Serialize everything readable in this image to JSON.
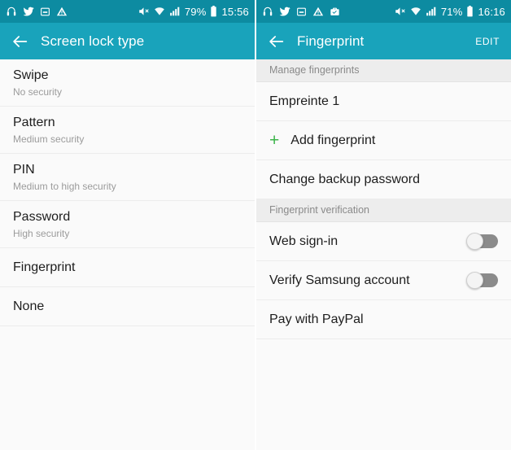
{
  "screens": [
    {
      "id": "screen-lock-type",
      "statusbar": {
        "left_icons": [
          "headphones-icon",
          "twitter-icon",
          "screenshot-icon",
          "warning-icon"
        ],
        "right_icons": [
          "mute-icon",
          "wifi-icon",
          "signal-icon"
        ],
        "battery": "79%",
        "battery_icon": "battery-icon",
        "time": "15:56"
      },
      "actionbar": {
        "back_icon": "back-arrow-icon",
        "title": "Screen lock type",
        "action_label": ""
      },
      "rows": [
        {
          "type": "item",
          "title": "Swipe",
          "sub": "No security"
        },
        {
          "type": "item",
          "title": "Pattern",
          "sub": "Medium security"
        },
        {
          "type": "item",
          "title": "PIN",
          "sub": "Medium to high security"
        },
        {
          "type": "item",
          "title": "Password",
          "sub": "High security"
        },
        {
          "type": "item",
          "title": "Fingerprint",
          "sub": ""
        },
        {
          "type": "item",
          "title": "None",
          "sub": ""
        }
      ]
    },
    {
      "id": "fingerprint",
      "statusbar": {
        "left_icons": [
          "headphones-icon",
          "twitter-icon",
          "screenshot-icon",
          "warning-icon",
          "briefcase-icon"
        ],
        "right_icons": [
          "mute-icon",
          "wifi-icon",
          "signal-icon"
        ],
        "battery": "71%",
        "battery_icon": "battery-icon",
        "time": "16:16"
      },
      "actionbar": {
        "back_icon": "back-arrow-icon",
        "title": "Fingerprint",
        "action_label": "EDIT"
      },
      "rows": [
        {
          "type": "header",
          "title": "Manage fingerprints"
        },
        {
          "type": "item",
          "title": "Empreinte 1"
        },
        {
          "type": "add",
          "title": "Add fingerprint",
          "icon": "plus-icon",
          "glyph": "+"
        },
        {
          "type": "item",
          "title": "Change backup password"
        },
        {
          "type": "header",
          "title": "Fingerprint verification"
        },
        {
          "type": "toggle",
          "title": "Web sign-in",
          "on": false
        },
        {
          "type": "toggle",
          "title": "Verify Samsung account",
          "on": false
        },
        {
          "type": "item",
          "title": "Pay with PayPal"
        }
      ]
    }
  ],
  "colors": {
    "status_bar": "#0d8ba1",
    "action_bar": "#19a3bb",
    "accent_green": "#3cb44a",
    "list_bg": "#fafafa",
    "section_bg": "#ededed",
    "title_text": "#1d1d1d",
    "sub_text": "#9b9b9b"
  }
}
